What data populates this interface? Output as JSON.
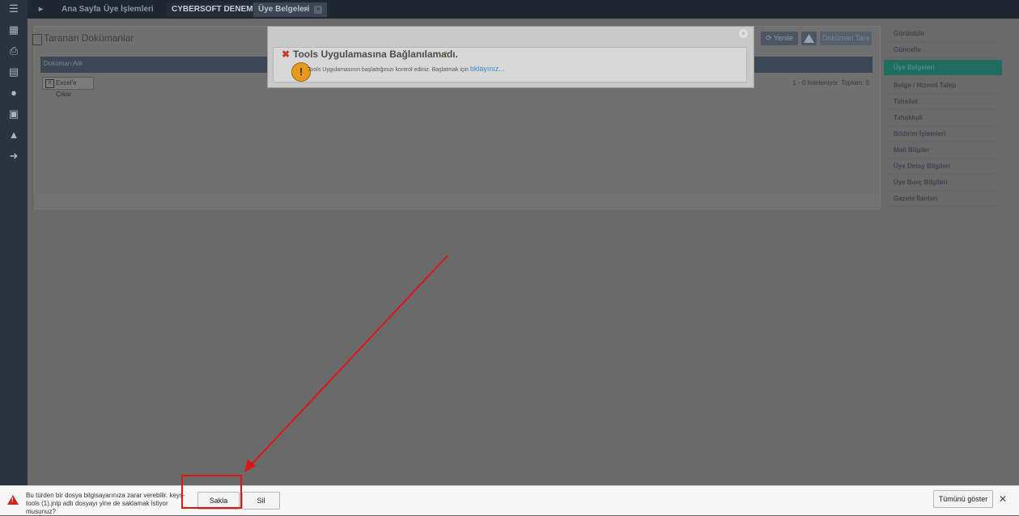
{
  "tabs": [
    {
      "label": "Ana Sayfa"
    },
    {
      "label": "Üye İşlemleri"
    },
    {
      "label": "CYBERSOFT DENEME"
    },
    {
      "label": "Üye Belgeleri"
    }
  ],
  "panel": {
    "title": "Taranan Dokümanlar",
    "grid_header": "Doküman Adı",
    "excel_label": "Excel'e Çıkar",
    "paging": "1 - 0 listeleniyor. Toplam: 0",
    "refresh_label": "Yenile",
    "scan_label": "Doküman Tara"
  },
  "sidenav": {
    "items": [
      "Görüntüle",
      "Güncelle",
      "Üye Belgeleri",
      "Belge / Hizmet Talep",
      "Tahsilat",
      "Tahakkuk",
      "Bildirim İşlemleri",
      "Mali Bilgiler",
      "Üye Detay Bilgileri",
      "Üye Borç Bilgileri",
      "Gazete İlanları"
    ],
    "selected_index": 2
  },
  "dialog": {
    "title": "Tools Uygulamasına Bağlanılamadı.",
    "body": "Tools Uygulamasının başlattığınızı kontrol ediniz. Başlatmak için",
    "link": "tıklayınız..."
  },
  "download_bar": {
    "message": "Bu türden bir dosya bilgisayarınıza zarar verebilir. keys-tools (1).jnlp adlı dosyayı yine de saklamak istiyor musunuz?",
    "keep_label": "Sakla",
    "delete_label": "Sil",
    "show_all_label": "Tümünü göster",
    "close_glyph": "✕"
  },
  "colors": {
    "accent_teal": "#1f6d61",
    "warning_red": "#d0271d",
    "annotation_red": "#e01414"
  }
}
